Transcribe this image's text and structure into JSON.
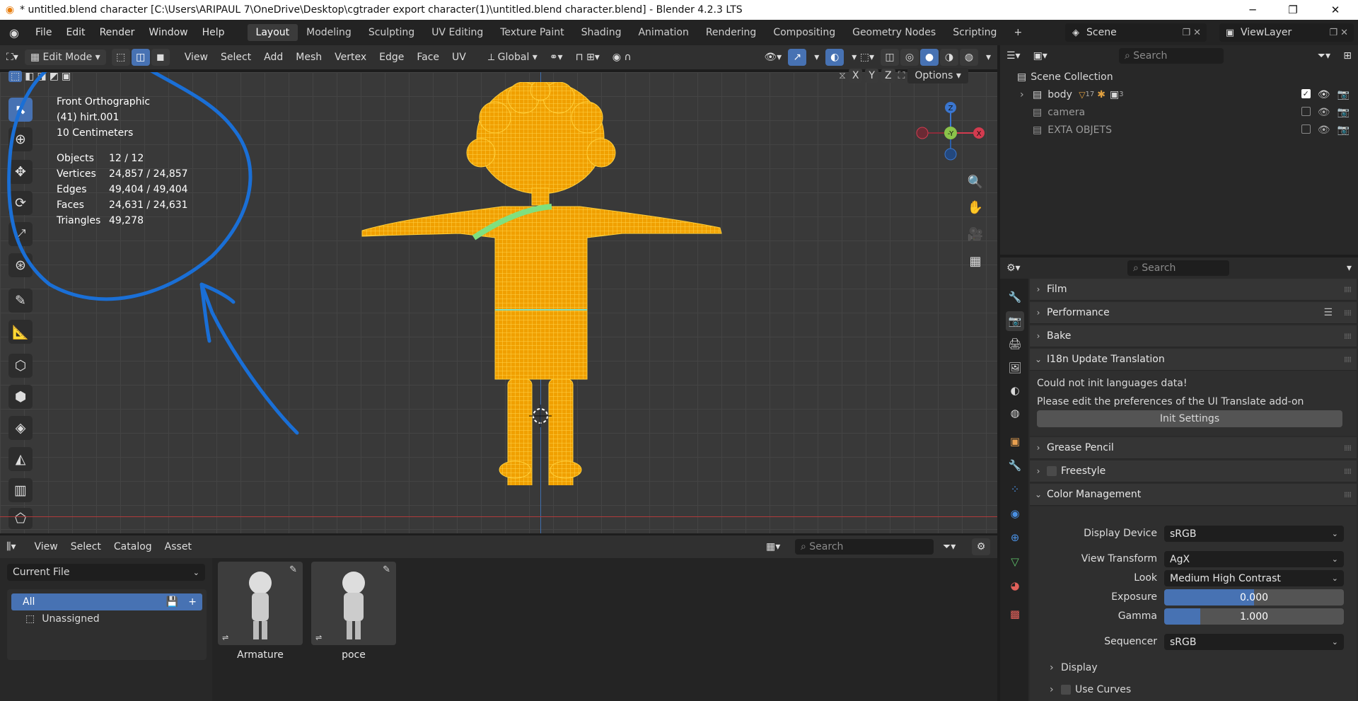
{
  "window": {
    "title": "* untitled.blend character [C:\\Users\\ARIPAUL 7\\OneDrive\\Desktop\\cgtrader export character(1)\\untitled.blend character.blend] - Blender 4.2.3 LTS",
    "minimize": "─",
    "maximize": "❐",
    "close": "✕"
  },
  "menu": [
    "File",
    "Edit",
    "Render",
    "Window",
    "Help"
  ],
  "workspaces": [
    "Layout",
    "Modeling",
    "Sculpting",
    "UV Editing",
    "Texture Paint",
    "Shading",
    "Animation",
    "Rendering",
    "Compositing",
    "Geometry Nodes",
    "Scripting"
  ],
  "active_workspace": "Layout",
  "scene": {
    "name": "Scene",
    "view_layer": "ViewLayer"
  },
  "viewport_header": {
    "mode": "Edit Mode",
    "menus": [
      "View",
      "Select",
      "Add",
      "Mesh",
      "Vertex",
      "Edge",
      "Face",
      "UV"
    ],
    "orientation": "Global",
    "axes": [
      "X",
      "Y",
      "Z"
    ],
    "options": "Options"
  },
  "overlay": {
    "view_name": "Front Orthographic",
    "object_name": "(41) hirt.001",
    "scale": "10 Centimeters",
    "stats": [
      {
        "label": "Objects",
        "value": "12 / 12"
      },
      {
        "label": "Vertices",
        "value": "24,857 / 24,857"
      },
      {
        "label": "Edges",
        "value": "49,404 / 49,404"
      },
      {
        "label": "Faces",
        "value": "24,631 / 24,631"
      },
      {
        "label": "Triangles",
        "value": "49,278"
      }
    ]
  },
  "gizmo": {
    "z": "Z",
    "y": "-Y",
    "x": "X"
  },
  "outliner": {
    "search_placeholder": "Search",
    "root": "Scene Collection",
    "items": [
      {
        "name": "body",
        "badge1": "17",
        "badge2": "3"
      },
      {
        "name": "camera"
      },
      {
        "name": "EXTA OBJETS"
      }
    ]
  },
  "properties": {
    "search_placeholder": "Search",
    "sections": {
      "film": "Film",
      "performance": "Performance",
      "bake": "Bake",
      "i18n": "I18n Update Translation",
      "grease_pencil": "Grease Pencil",
      "freestyle": "Freestyle",
      "color_management": "Color Management",
      "display": "Display",
      "use_curves": "Use Curves"
    },
    "i18n_msg1": "Could not init languages data!",
    "i18n_msg2": "Please edit the preferences of the UI Translate add-on",
    "init_settings": "Init Settings",
    "color": {
      "display_device_label": "Display Device",
      "display_device": "sRGB",
      "view_transform_label": "View Transform",
      "view_transform": "AgX",
      "look_label": "Look",
      "look": "Medium High Contrast",
      "exposure_label": "Exposure",
      "exposure": "0.000",
      "exposure_fill": 0.5,
      "gamma_label": "Gamma",
      "gamma": "1.000",
      "gamma_fill": 0.2,
      "sequencer_label": "Sequencer",
      "sequencer": "sRGB"
    }
  },
  "asset_browser": {
    "menus": [
      "View",
      "Select",
      "Catalog",
      "Asset"
    ],
    "search_placeholder": "Search",
    "library": "Current File",
    "catalogs": [
      "All",
      "Unassigned"
    ],
    "assets": [
      "Armature",
      "poce"
    ]
  },
  "colors": {
    "accent": "#4772b3",
    "mesh": "#ffb400",
    "annotation": "#1a6fd6"
  }
}
